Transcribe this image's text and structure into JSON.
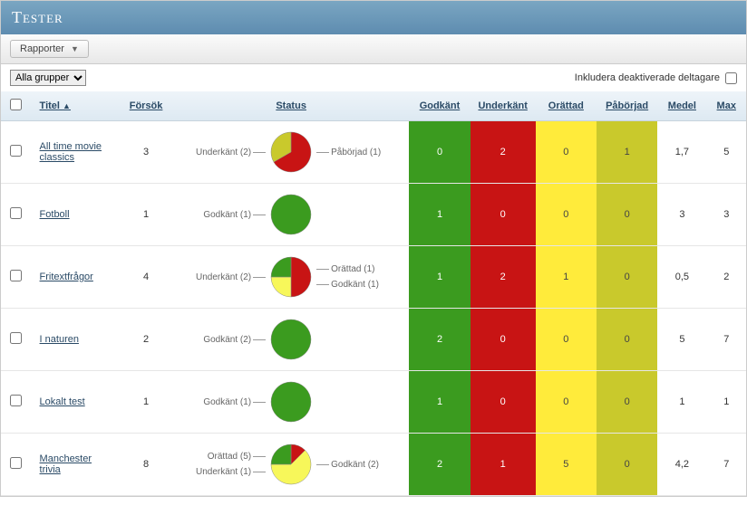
{
  "header": {
    "title": "Tester"
  },
  "toolbar": {
    "rapporter": "Rapporter"
  },
  "filter": {
    "group_select": "Alla grupper",
    "include_deactivated": "Inkludera deaktiverade deltagare"
  },
  "columns": {
    "titel": "Titel",
    "forsok": "Försök",
    "status": "Status",
    "godkant": "Godkänt",
    "underkant": "Underkänt",
    "orattad": "Orättad",
    "paborjad": "Påbörjad",
    "medel": "Medel",
    "max": "Max"
  },
  "status_labels": {
    "godkant": "Godkänt",
    "underkant": "Underkänt",
    "orattad": "Orättad",
    "paborjad": "Påbörjad"
  },
  "rows": [
    {
      "title": "All time movie classics",
      "forsok": "3",
      "godkant": "0",
      "underkant": "2",
      "orattad": "0",
      "paborjad": "1",
      "medel": "1,7",
      "max": "5",
      "pie": {
        "underkant": 2,
        "paborjad": 1
      },
      "labels_left": [
        {
          "k": "underkant",
          "n": 2
        }
      ],
      "labels_right": [
        {
          "k": "paborjad",
          "n": 1
        }
      ]
    },
    {
      "title": "Fotboll",
      "forsok": "1",
      "godkant": "1",
      "underkant": "0",
      "orattad": "0",
      "paborjad": "0",
      "medel": "3",
      "max": "3",
      "pie": {
        "godkant": 1
      },
      "labels_left": [
        {
          "k": "godkant",
          "n": 1
        }
      ],
      "labels_right": []
    },
    {
      "title": "Fritextfrågor",
      "forsok": "4",
      "godkant": "1",
      "underkant": "2",
      "orattad": "1",
      "paborjad": "0",
      "medel": "0,5",
      "max": "2",
      "pie": {
        "underkant": 2,
        "orattad": 1,
        "godkant": 1
      },
      "labels_left": [
        {
          "k": "underkant",
          "n": 2
        }
      ],
      "labels_right": [
        {
          "k": "orattad",
          "n": 1
        },
        {
          "k": "godkant",
          "n": 1
        }
      ]
    },
    {
      "title": "I naturen",
      "forsok": "2",
      "godkant": "2",
      "underkant": "0",
      "orattad": "0",
      "paborjad": "0",
      "medel": "5",
      "max": "7",
      "pie": {
        "godkant": 2
      },
      "labels_left": [
        {
          "k": "godkant",
          "n": 2
        }
      ],
      "labels_right": []
    },
    {
      "title": "Lokalt test",
      "forsok": "1",
      "godkant": "1",
      "underkant": "0",
      "orattad": "0",
      "paborjad": "0",
      "medel": "1",
      "max": "1",
      "pie": {
        "godkant": 1
      },
      "labels_left": [
        {
          "k": "godkant",
          "n": 1
        }
      ],
      "labels_right": []
    },
    {
      "title": "Manchester trivia",
      "forsok": "8",
      "godkant": "2",
      "underkant": "1",
      "orattad": "5",
      "paborjad": "0",
      "medel": "4,2",
      "max": "7",
      "pie": {
        "orattad": 5,
        "godkant": 2,
        "underkant": 1
      },
      "labels_left": [
        {
          "k": "orattad",
          "n": 5
        },
        {
          "k": "underkant",
          "n": 1
        }
      ],
      "labels_right": [
        {
          "k": "godkant",
          "n": 2
        }
      ]
    }
  ],
  "colors": {
    "godkant": "#3b9b1f",
    "underkant": "#c81414",
    "orattad": "#f7f75a",
    "paborjad": "#c9c92c"
  }
}
